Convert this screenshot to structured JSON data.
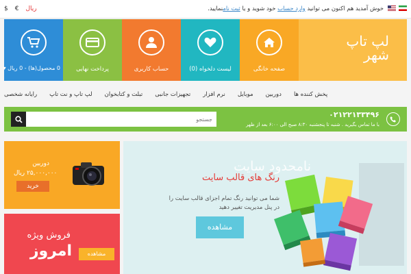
{
  "topbar": {
    "currencies": [
      "$",
      "€",
      "ریال"
    ],
    "active_currency_index": 2,
    "welcome": "خوش آمدید هم اکنون می توانید",
    "login_link": "وارد حساب",
    "middle": "خود شوید و یا",
    "register_link": "ثبت نام",
    "end": "نمایید."
  },
  "brand": {
    "line1": "لپ تاپ",
    "line2": "شهر"
  },
  "tiles": [
    {
      "label": "صفحه خانگی",
      "icon": "home-icon",
      "color": "#f9a825"
    },
    {
      "label": "لیست دلخواه (0)",
      "icon": "heart-icon",
      "color": "#21b7c1"
    },
    {
      "label": "حساب کاربری",
      "icon": "user-icon",
      "color": "#f27a2f"
    },
    {
      "label": "پرداخت نهایی",
      "icon": "credit-card-icon",
      "color": "#8bc043"
    },
    {
      "label": "0 محصول(ها) - 0 ریال",
      "icon": "cart-icon",
      "color": "#2e8dd7"
    }
  ],
  "nav": [
    "رایانه شخصی",
    "لپ تاپ و نت تاپ",
    "تبلت و کتابخوان",
    "تجهیزات جانبی",
    "نرم افزار",
    "موبایل",
    "دوربین",
    "پخش کننده ها"
  ],
  "contact": {
    "phone": "۰۲۱۲۲۱۳۳۴۹۶",
    "hours": "با ما تماس بگیرید . شنبه تا پنجشنبه ۸:۳۰ صبح الی ۶:۰۰ بعد از ظهر"
  },
  "search": {
    "placeholder": "جستجو"
  },
  "promo_camera": {
    "name": "دوربین",
    "price": "۲۵,۰۰۰,۰۰۰ ریال",
    "button": "خرید"
  },
  "promo_sale": {
    "title": "فروش ویژه",
    "today": "امروز",
    "button": "مشاهده"
  },
  "slider": {
    "ghost_text": "نامحدود سایت",
    "title": "رنگ های قالب سایت",
    "description": "شما می توانید رنگ تمام اجزای قالب سایت را در پنل مدیریت تغییر دهید",
    "button": "مشاهده"
  },
  "colors": {
    "green": "#7cc242",
    "blue": "#2e8dd7",
    "orange": "#f27a2f",
    "teal": "#21b7c1",
    "yellow": "#f9a825",
    "red": "#f0474f"
  }
}
